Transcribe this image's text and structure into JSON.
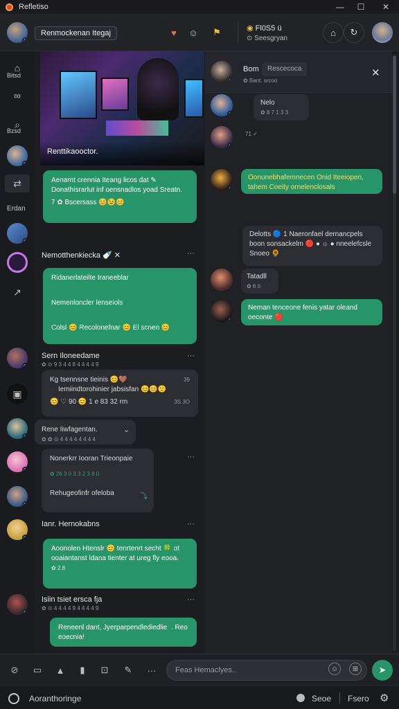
{
  "window": {
    "title": "Refletiso",
    "controls": [
      "—",
      "☐",
      "✕"
    ]
  },
  "header": {
    "room_name": "Renmockenan Itegaj",
    "right_name": "Fl0S5",
    "right_status": "Seesgryan",
    "right_badge": "ü"
  },
  "sidebar": {
    "label1": "Bitsd",
    "label2": "Bzsd",
    "section": "Erdan"
  },
  "hero": {
    "caption": "Renttikaooctor."
  },
  "left_messages": {
    "m1": {
      "text": "Aenarnt crennia Iteang licos dat ✎ Donathisrarlut inf oensnadlos yoad Sreatn.",
      "reactions": "7 ✿ Bscersass 😊😉😊"
    },
    "s2": {
      "name": "Nemotthenk​iecka 🍼 ✕"
    },
    "m2a": {
      "text": "Ridanerlateilte Iraneeblar"
    },
    "m2b": {
      "text": "Nemenloncler lenseiols"
    },
    "m2c": {
      "text": "Colsl 😊 Recolonefnar 😊 El scnen 😊"
    },
    "s3": {
      "name": "Sern Iloneedame",
      "meta": "✿ ⊙ 9 3 4 4 8 4 4 4 4 9"
    },
    "m3": {
      "line1": "Kg tsennsne tieinis 😊🤎",
      "time1": "39",
      "line2": "Iemiindtorohinier jabsisfan 😊😊🙂",
      "reactions": "😊 ♡ 90 😊 1 e 83 32 rm",
      "time2": "3S 3O"
    },
    "s4": {
      "name": "Rene Iiwfagentan.",
      "meta": "✿ ✿ ⊙ 4 4 4 4 4 4 4 4"
    },
    "m4": {
      "line1": "Nonerkrr Iooran Trieonpaie",
      "line2": "✿ 26 3 0  3 3 2 3 8 0",
      "line3": "Rehugeofinfr ofeloba"
    },
    "s5": {
      "name": "Ianr. Hernokabns"
    },
    "m5": {
      "text": "Aoonolen Htenslr 😊 tenrtenrt secht 🍀 ot ooaiantanst ldana tienter at ureg fly eooa.",
      "time": "✿ 2.8"
    },
    "s6": {
      "name": "Isiin tsiet ersca fja",
      "meta": "✿ ⊙ 4 4 4 4 9 4 4 4 4 9"
    },
    "m6": {
      "text": "Reneenl dant, Jyerparpendlediedlie .. Reo eoecnia!"
    }
  },
  "right_panel": {
    "top": {
      "name": "Bom",
      "pill": "Rescecoca",
      "meta": "✿ Bant. srcoo"
    },
    "r1": {
      "name": "Nelo",
      "meta": "✿ 8 7 1 3 3"
    },
    "r2": {
      "meta": "71  ✓"
    },
    "r3": {
      "text": "Oonunebhafemnecen Onid Iteeiopen, tahem Coeity ornelenclosals"
    },
    "r4": {
      "text": "Delotts 🔵 1 Naeronfael dernancpels boon sonsackelm 🔴 ● ☼ ● nneelefcsle Snoeo 🌻"
    },
    "r5": {
      "name": "Tatadll",
      "meta": "✿ 6 ö"
    },
    "r6": {
      "text": "Neman tenceone fenis yatar oleand oeconte 🔴"
    }
  },
  "composer": {
    "placeholder": "Feas Hemaclyes.."
  },
  "footer": {
    "left": "Aoranthoringe",
    "right1": "Seoe",
    "right2": "Fsero"
  }
}
